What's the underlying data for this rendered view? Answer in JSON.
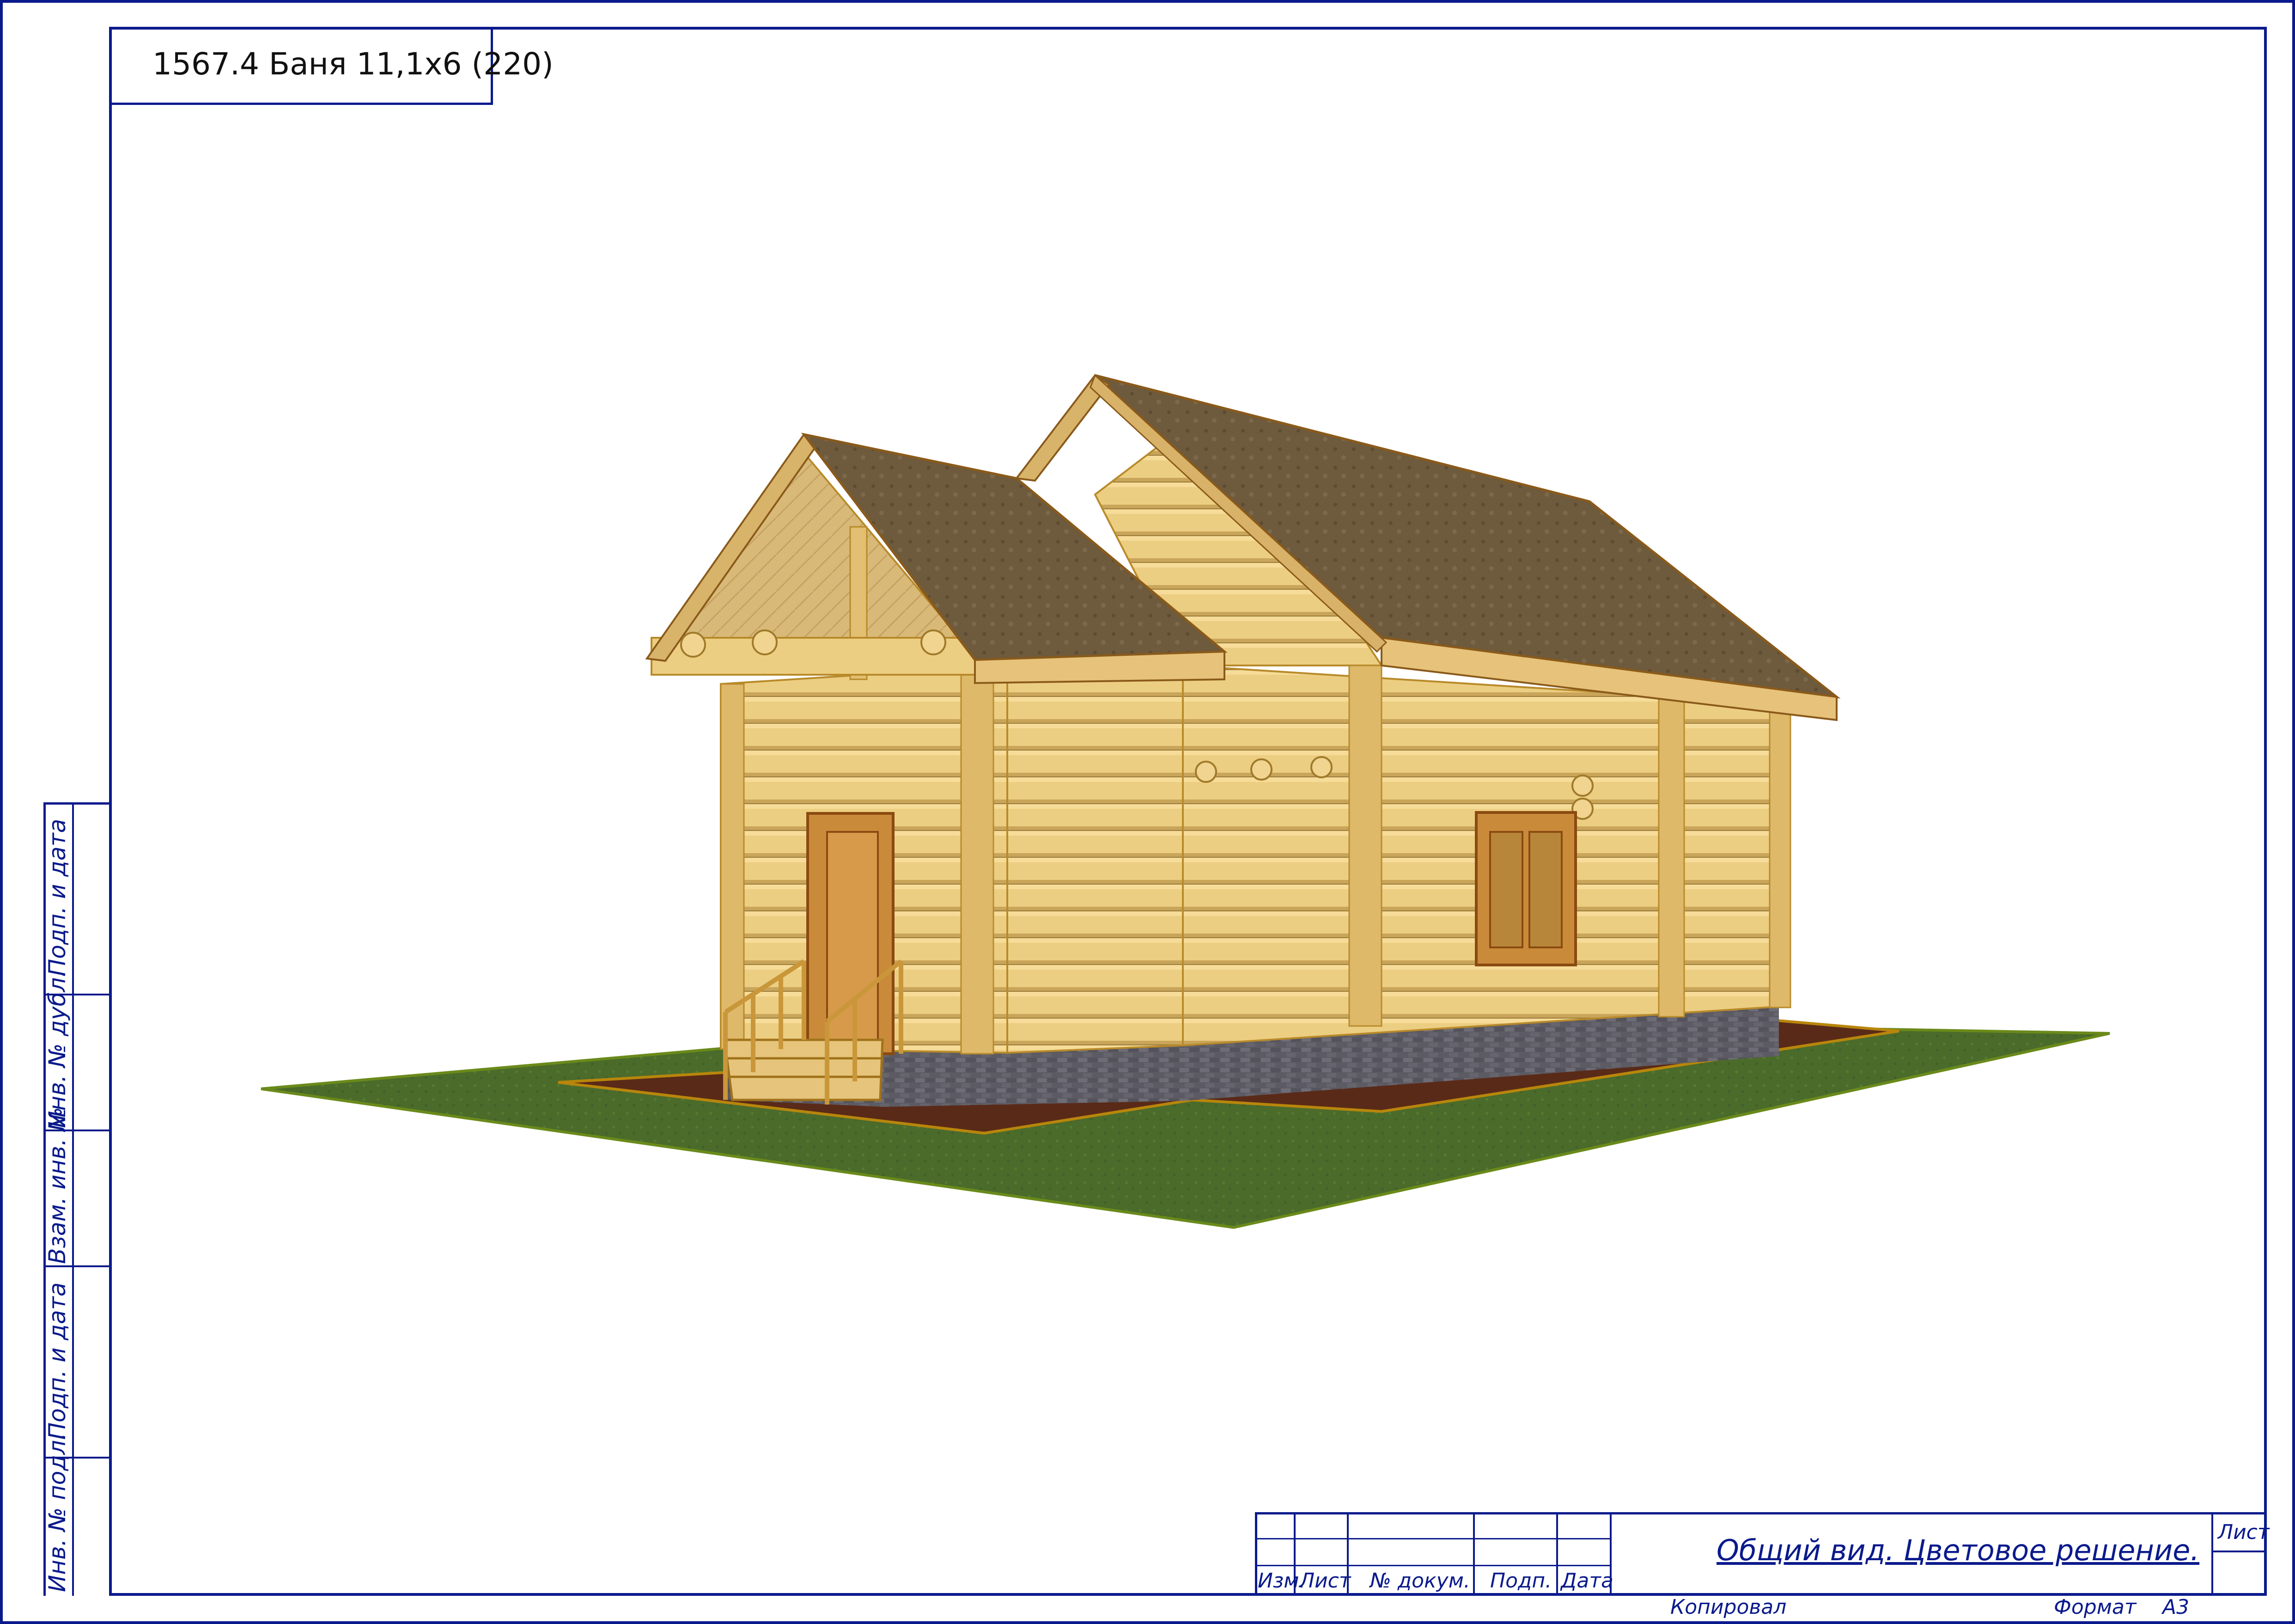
{
  "sheet": {
    "project_title": "1567.4 Баня 11,1х6 (220)"
  },
  "side_stamp": {
    "labels": [
      "Подп. и дата",
      "Инв. № дубл.",
      "Взам. инв. №",
      "Подп. и дата",
      "Инв. № подл."
    ]
  },
  "title_block": {
    "columns": [
      "Изм.",
      "Лист",
      "№ докум.",
      "Подп.",
      "Дата"
    ],
    "description": "Общий вид. Цветовое решение.",
    "sheet_label": "Лист",
    "copied_label": "Копировал",
    "format_label": "Формат",
    "format_value": "А3"
  },
  "colors": {
    "frame": "#0a1a8c",
    "logs": "#e8c87a",
    "roof": "#6e5a3c",
    "grass": "#4a6a2a",
    "soil": "#5a2a18",
    "plinth": "#5a5860"
  }
}
